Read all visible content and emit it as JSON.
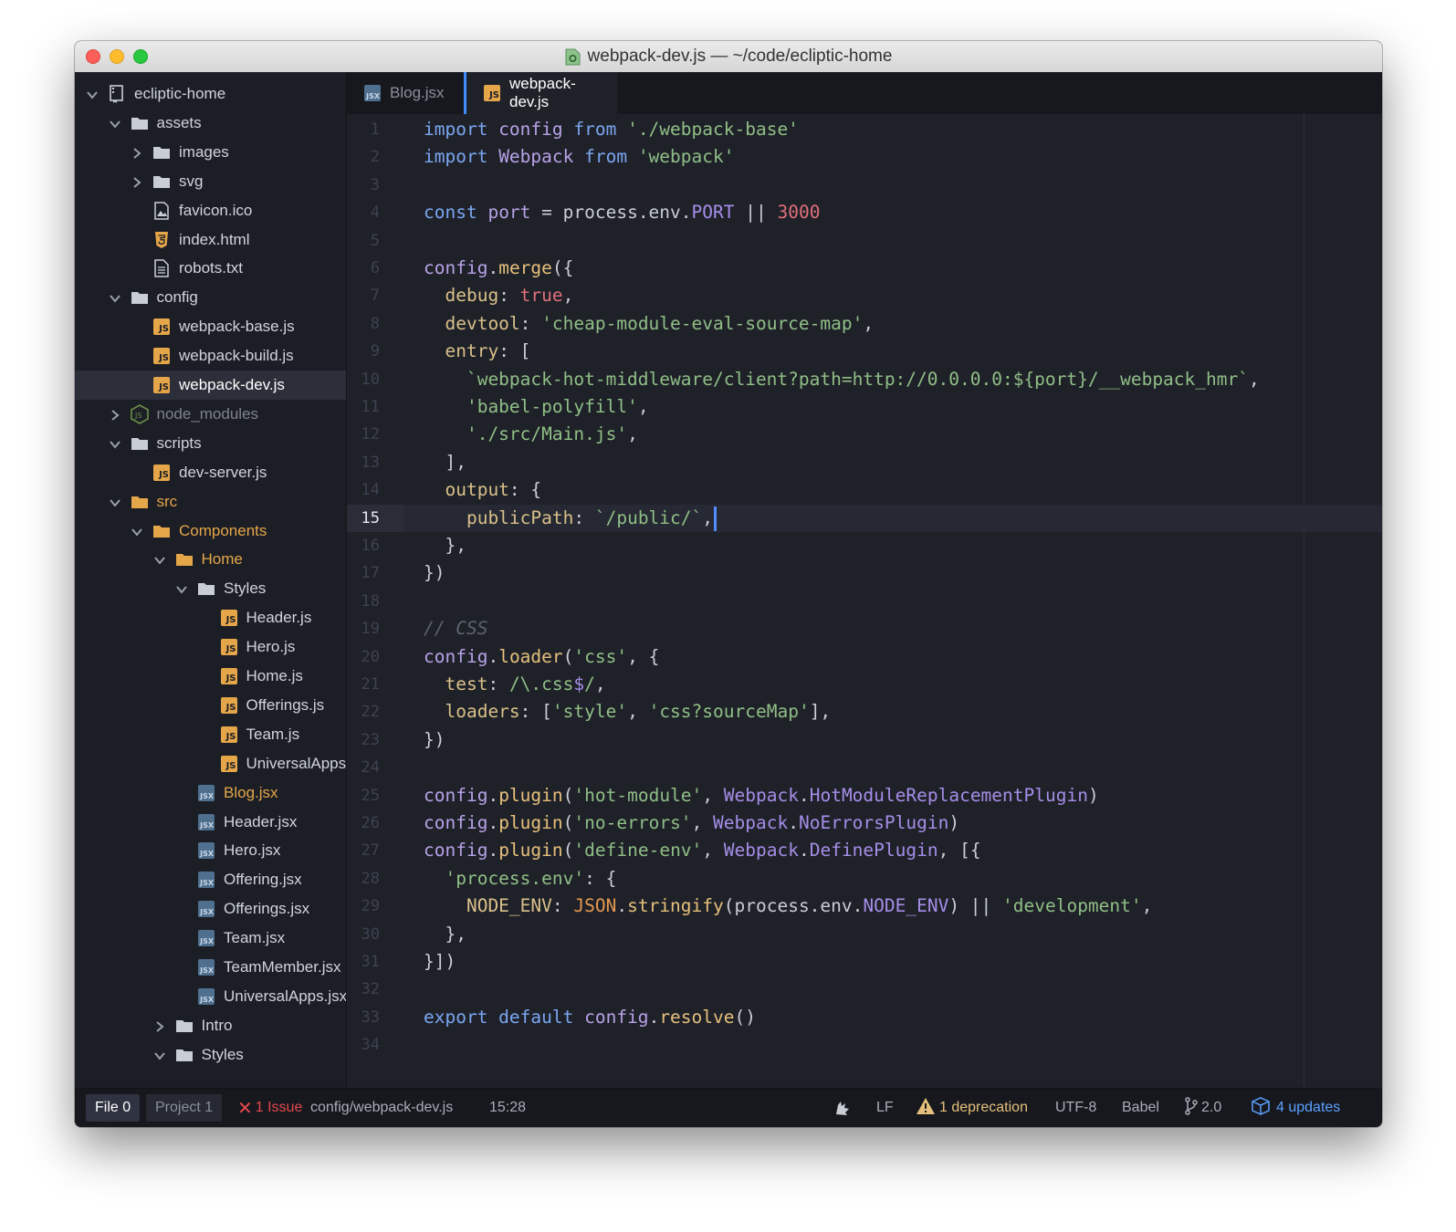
{
  "window": {
    "title": "webpack-dev.js — ~/code/ecliptic-home"
  },
  "colors": {
    "accent": "#3f8cff",
    "background": "#1f2129",
    "sidebar": "#1c1e25",
    "issue": "#e5484d",
    "updates": "#5aa0ff"
  },
  "sidebar": {
    "rows": [
      {
        "label": "ecliptic-home",
        "type": "repo",
        "depth": 0,
        "chevron": "down",
        "color": "#d0d4dc"
      },
      {
        "label": "assets",
        "type": "folder",
        "depth": 1,
        "chevron": "down",
        "color": "#d0d4dc"
      },
      {
        "label": "images",
        "type": "folder",
        "depth": 2,
        "chevron": "right",
        "color": "#d0d4dc"
      },
      {
        "label": "svg",
        "type": "folder",
        "depth": 2,
        "chevron": "right",
        "color": "#d0d4dc"
      },
      {
        "label": "favicon.ico",
        "type": "image",
        "depth": 2,
        "chevron": "none",
        "color": "#d0d4dc"
      },
      {
        "label": "index.html",
        "type": "html",
        "depth": 2,
        "chevron": "none",
        "color": "#d0d4dc"
      },
      {
        "label": "robots.txt",
        "type": "text",
        "depth": 2,
        "chevron": "none",
        "color": "#d0d4dc"
      },
      {
        "label": "config",
        "type": "folder",
        "depth": 1,
        "chevron": "down",
        "color": "#d0d4dc"
      },
      {
        "label": "webpack-base.js",
        "type": "js",
        "depth": 2,
        "chevron": "none",
        "color": "#d0d4dc"
      },
      {
        "label": "webpack-build.js",
        "type": "js",
        "depth": 2,
        "chevron": "none",
        "color": "#d0d4dc"
      },
      {
        "label": "webpack-dev.js",
        "type": "js",
        "depth": 2,
        "chevron": "none",
        "color": "#ffffff",
        "selected": true
      },
      {
        "label": "node_modules",
        "type": "node",
        "depth": 1,
        "chevron": "right",
        "color": "#7d8390"
      },
      {
        "label": "scripts",
        "type": "folder",
        "depth": 1,
        "chevron": "down",
        "color": "#d0d4dc"
      },
      {
        "label": "dev-server.js",
        "type": "js",
        "depth": 2,
        "chevron": "none",
        "color": "#d0d4dc"
      },
      {
        "label": "src",
        "type": "folder-mod",
        "depth": 1,
        "chevron": "down",
        "color": "#e5a64a"
      },
      {
        "label": "Components",
        "type": "folder-mod",
        "depth": 2,
        "chevron": "down",
        "color": "#e5a64a"
      },
      {
        "label": "Home",
        "type": "folder-mod",
        "depth": 3,
        "chevron": "down",
        "color": "#e5a64a"
      },
      {
        "label": "Styles",
        "type": "folder",
        "depth": 4,
        "chevron": "down",
        "color": "#d0d4dc"
      },
      {
        "label": "Header.js",
        "type": "js",
        "depth": 5,
        "chevron": "none",
        "color": "#d0d4dc"
      },
      {
        "label": "Hero.js",
        "type": "js",
        "depth": 5,
        "chevron": "none",
        "color": "#d0d4dc"
      },
      {
        "label": "Home.js",
        "type": "js",
        "depth": 5,
        "chevron": "none",
        "color": "#d0d4dc"
      },
      {
        "label": "Offerings.js",
        "type": "js",
        "depth": 5,
        "chevron": "none",
        "color": "#d0d4dc"
      },
      {
        "label": "Team.js",
        "type": "js",
        "depth": 5,
        "chevron": "none",
        "color": "#d0d4dc"
      },
      {
        "label": "UniversalApps.js",
        "type": "js",
        "depth": 5,
        "chevron": "none",
        "color": "#d0d4dc"
      },
      {
        "label": "Blog.jsx",
        "type": "jsx",
        "depth": 4,
        "chevron": "none",
        "color": "#e5a64a"
      },
      {
        "label": "Header.jsx",
        "type": "jsx",
        "depth": 4,
        "chevron": "none",
        "color": "#d0d4dc"
      },
      {
        "label": "Hero.jsx",
        "type": "jsx",
        "depth": 4,
        "chevron": "none",
        "color": "#d0d4dc"
      },
      {
        "label": "Offering.jsx",
        "type": "jsx",
        "depth": 4,
        "chevron": "none",
        "color": "#d0d4dc"
      },
      {
        "label": "Offerings.jsx",
        "type": "jsx",
        "depth": 4,
        "chevron": "none",
        "color": "#d0d4dc"
      },
      {
        "label": "Team.jsx",
        "type": "jsx",
        "depth": 4,
        "chevron": "none",
        "color": "#d0d4dc"
      },
      {
        "label": "TeamMember.jsx",
        "type": "jsx",
        "depth": 4,
        "chevron": "none",
        "color": "#d0d4dc"
      },
      {
        "label": "UniversalApps.jsx",
        "type": "jsx",
        "depth": 4,
        "chevron": "none",
        "color": "#d0d4dc"
      },
      {
        "label": "Intro",
        "type": "folder",
        "depth": 3,
        "chevron": "right",
        "color": "#d0d4dc"
      },
      {
        "label": "Styles",
        "type": "folder",
        "depth": 3,
        "chevron": "down",
        "color": "#d0d4dc"
      }
    ]
  },
  "tabs": [
    {
      "label": "Blog.jsx",
      "type": "jsx",
      "active": false
    },
    {
      "label": "webpack-dev.js",
      "type": "js",
      "active": true
    }
  ],
  "editor": {
    "cursor_line": 15,
    "lines": [
      [
        [
          "kw",
          "import "
        ],
        [
          "id",
          "config "
        ],
        [
          "kw",
          "from "
        ],
        [
          "str",
          "'./webpack-base'"
        ]
      ],
      [
        [
          "kw",
          "import "
        ],
        [
          "id",
          "Webpack "
        ],
        [
          "kw",
          "from "
        ],
        [
          "str",
          "'webpack'"
        ]
      ],
      [],
      [
        [
          "kw",
          "const "
        ],
        [
          "id",
          "port "
        ],
        [
          "pun",
          "= process.env."
        ],
        [
          "const",
          "PORT"
        ],
        [
          "pun",
          " || "
        ],
        [
          "num",
          "3000"
        ]
      ],
      [],
      [
        [
          "id",
          "config"
        ],
        [
          "pun",
          "."
        ],
        [
          "fn",
          "merge"
        ],
        [
          "pun",
          "({"
        ]
      ],
      [
        [
          "prop",
          "  debug"
        ],
        [
          "pun",
          ": "
        ],
        [
          "bool",
          "true"
        ],
        [
          "pun",
          ","
        ]
      ],
      [
        [
          "prop",
          "  devtool"
        ],
        [
          "pun",
          ": "
        ],
        [
          "str",
          "'cheap-module-eval-source-map'"
        ],
        [
          "pun",
          ","
        ]
      ],
      [
        [
          "prop",
          "  entry"
        ],
        [
          "pun",
          ": ["
        ]
      ],
      [
        [
          "str",
          "    `webpack-hot-middleware/client?path=http://0.0.0.0:${port}/__webpack_hmr`"
        ],
        [
          "pun",
          ","
        ]
      ],
      [
        [
          "str",
          "    'babel-polyfill'"
        ],
        [
          "pun",
          ","
        ]
      ],
      [
        [
          "str",
          "    './src/Main.js'"
        ],
        [
          "pun",
          ","
        ]
      ],
      [
        [
          "pun",
          "  ],"
        ]
      ],
      [
        [
          "prop",
          "  output"
        ],
        [
          "pun",
          ": {"
        ]
      ],
      [
        [
          "prop",
          "    publicPath"
        ],
        [
          "pun",
          ": "
        ],
        [
          "str",
          "`/public/`"
        ],
        [
          "pun",
          ","
        ]
      ],
      [
        [
          "pun",
          "  },"
        ]
      ],
      [
        [
          "pun",
          "})"
        ]
      ],
      [],
      [
        [
          "cmt",
          "// CSS"
        ]
      ],
      [
        [
          "id",
          "config"
        ],
        [
          "pun",
          "."
        ],
        [
          "fn",
          "loader"
        ],
        [
          "pun",
          "("
        ],
        [
          "str",
          "'css'"
        ],
        [
          "pun",
          ", {"
        ]
      ],
      [
        [
          "prop",
          "  test"
        ],
        [
          "pun",
          ": "
        ],
        [
          "str",
          "/\\.css"
        ],
        [
          "const",
          "$"
        ],
        [
          "str",
          "/"
        ],
        [
          "pun",
          ","
        ]
      ],
      [
        [
          "prop",
          "  loaders"
        ],
        [
          "pun",
          ": ["
        ],
        [
          "str",
          "'style'"
        ],
        [
          "pun",
          ", "
        ],
        [
          "str",
          "'css?sourceMap'"
        ],
        [
          "pun",
          "],"
        ]
      ],
      [
        [
          "pun",
          "})"
        ]
      ],
      [],
      [
        [
          "id",
          "config"
        ],
        [
          "pun",
          "."
        ],
        [
          "fn",
          "plugin"
        ],
        [
          "pun",
          "("
        ],
        [
          "str",
          "'hot-module'"
        ],
        [
          "pun",
          ", "
        ],
        [
          "const",
          "Webpack"
        ],
        [
          "pun",
          "."
        ],
        [
          "const",
          "HotModuleReplacementPlugin"
        ],
        [
          "pun",
          ")"
        ]
      ],
      [
        [
          "id",
          "config"
        ],
        [
          "pun",
          "."
        ],
        [
          "fn",
          "plugin"
        ],
        [
          "pun",
          "("
        ],
        [
          "str",
          "'no-errors'"
        ],
        [
          "pun",
          ", "
        ],
        [
          "const",
          "Webpack"
        ],
        [
          "pun",
          "."
        ],
        [
          "const",
          "NoErrorsPlugin"
        ],
        [
          "pun",
          ")"
        ]
      ],
      [
        [
          "id",
          "config"
        ],
        [
          "pun",
          "."
        ],
        [
          "fn",
          "plugin"
        ],
        [
          "pun",
          "("
        ],
        [
          "str",
          "'define-env'"
        ],
        [
          "pun",
          ", "
        ],
        [
          "const",
          "Webpack"
        ],
        [
          "pun",
          "."
        ],
        [
          "const",
          "DefinePlugin"
        ],
        [
          "pun",
          ", [{"
        ]
      ],
      [
        [
          "str",
          "  'process.env'"
        ],
        [
          "pun",
          ": {"
        ]
      ],
      [
        [
          "prop",
          "    NODE_ENV"
        ],
        [
          "pun",
          ": "
        ],
        [
          "json",
          "JSON"
        ],
        [
          "pun",
          "."
        ],
        [
          "fn",
          "stringify"
        ],
        [
          "pun",
          "(process.env."
        ],
        [
          "const",
          "NODE_ENV"
        ],
        [
          "pun",
          ") || "
        ],
        [
          "str",
          "'development'"
        ],
        [
          "pun",
          ","
        ]
      ],
      [
        [
          "pun",
          "  },"
        ]
      ],
      [
        [
          "pun",
          "}])"
        ]
      ],
      [],
      [
        [
          "kw",
          "export default "
        ],
        [
          "id",
          "config"
        ],
        [
          "pun",
          "."
        ],
        [
          "fn",
          "resolve"
        ],
        [
          "pun",
          "()"
        ]
      ],
      []
    ]
  },
  "statusbar": {
    "file_tab": "File 0",
    "project_tab": "Project 1",
    "issues": "1 Issue",
    "path": "config/webpack-dev.js",
    "position": "15:28",
    "line_ending": "LF",
    "deprecation": "1 deprecation",
    "encoding": "UTF-8",
    "grammar": "Babel",
    "git": "2.0",
    "updates": "4 updates"
  }
}
